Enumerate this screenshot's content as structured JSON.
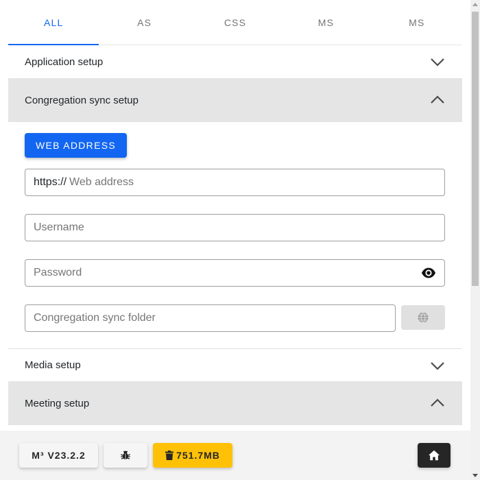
{
  "tabs": [
    {
      "label": "ALL",
      "active": true
    },
    {
      "label": "AS",
      "active": false
    },
    {
      "label": "CSS",
      "active": false
    },
    {
      "label": "MS",
      "active": false
    },
    {
      "label": "MS",
      "active": false
    }
  ],
  "sections": {
    "application": {
      "title": "Application setup",
      "expanded": false
    },
    "sync": {
      "title": "Congregation sync setup",
      "expanded": true
    },
    "media": {
      "title": "Media setup",
      "expanded": false
    },
    "meeting": {
      "title": "Meeting setup",
      "expanded": true
    }
  },
  "sync_form": {
    "web_address_button": "WEB ADDRESS",
    "url_prefix": "https://",
    "url_placeholder": "Web address",
    "username_placeholder": "Username",
    "password_placeholder": "Password",
    "folder_placeholder": "Congregation sync folder"
  },
  "footer": {
    "version": "M³ V23.2.2",
    "cache_size": "751.7MB"
  },
  "colors": {
    "accent": "#1266f1",
    "warning": "#ffc107",
    "dark": "#262626",
    "header_open_bg": "#e5e5e5"
  },
  "icons": {
    "chevron_down": "chevron-down-icon",
    "chevron_up": "chevron-up-icon",
    "eye": "eye-icon",
    "globe": "globe-icon",
    "bug": "bug-icon",
    "trash": "trash-icon",
    "home": "home-icon"
  }
}
